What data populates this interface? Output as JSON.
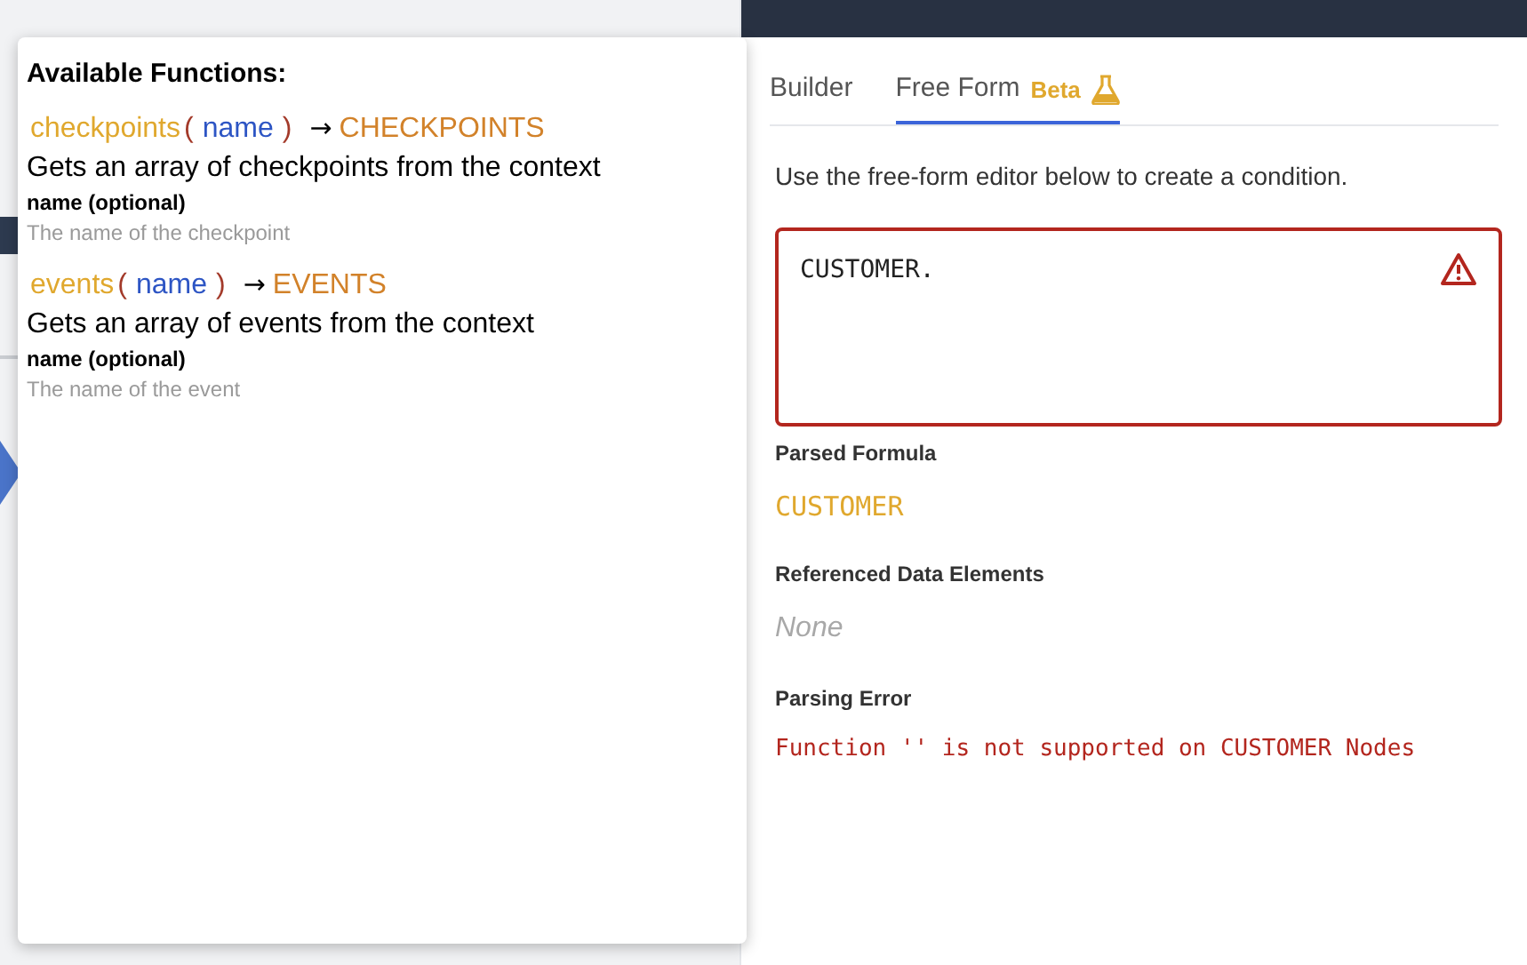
{
  "functions_popup": {
    "title": "Available Functions:",
    "functions": [
      {
        "name": "checkpoints",
        "open_paren": "(",
        "param": "name",
        "close_paren": ")",
        "arrow": "→",
        "returns": "CHECKPOINTS",
        "description": "Gets an array of checkpoints from the context",
        "param_label": "name (optional)",
        "param_description": "The name of the checkpoint"
      },
      {
        "name": "events",
        "open_paren": "(",
        "param": "name",
        "close_paren": ")",
        "arrow": "→",
        "returns": "EVENTS",
        "description": "Gets an array of events from the context",
        "param_label": "name (optional)",
        "param_description": "The name of the event"
      }
    ]
  },
  "tabs": [
    {
      "label": "Builder",
      "selected": false
    },
    {
      "label": "Free Form",
      "badge": "Beta",
      "selected": true
    }
  ],
  "instructions": "Use the free-form editor below to create a condition.",
  "editor": {
    "value": "CUSTOMER.",
    "error": true
  },
  "sections": [
    {
      "kind": "formula",
      "label": "Parsed Formula",
      "value": "CUSTOMER"
    },
    {
      "kind": "empty",
      "label": "Referenced Data Elements",
      "value": "None"
    },
    {
      "kind": "error",
      "label": "Parsing Error",
      "value": "Function '' is not supported on CUSTOMER Nodes"
    }
  ]
}
